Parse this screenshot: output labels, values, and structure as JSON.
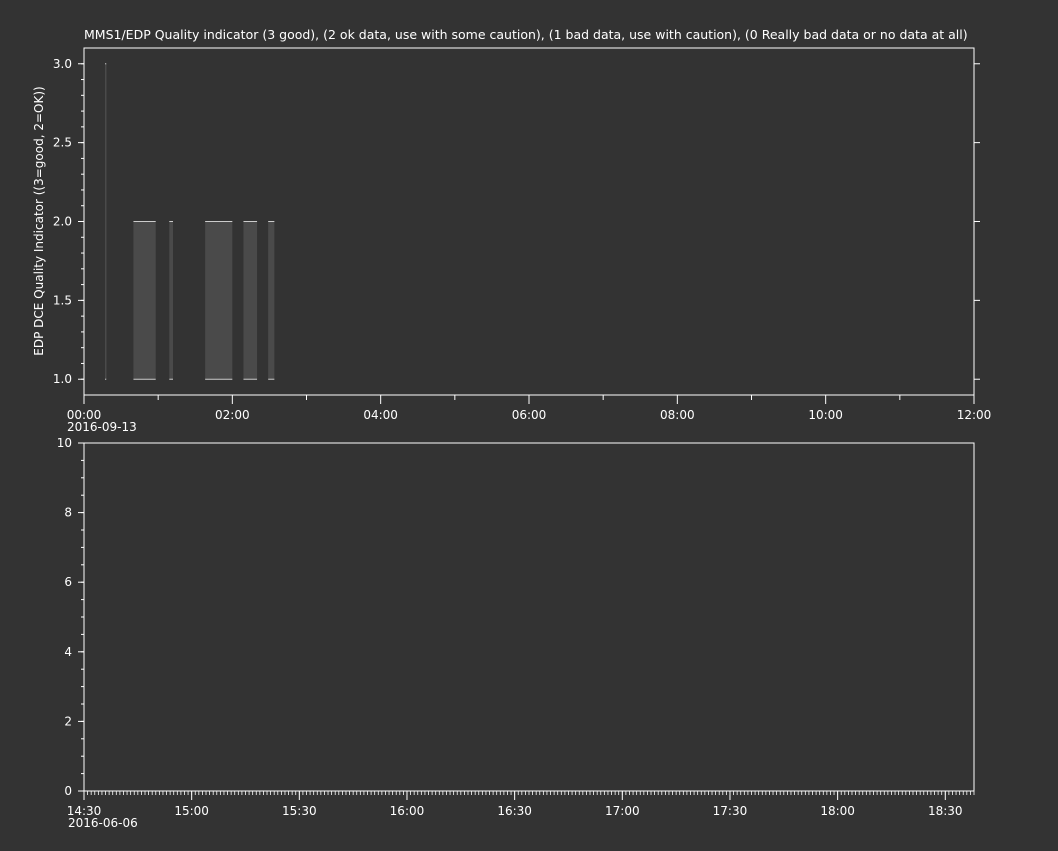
{
  "colors": {
    "background": "#333333",
    "foreground": "#ffffff",
    "data": "#4a4a4a",
    "trace": "#cccccc"
  },
  "chart_data": [
    {
      "type": "line",
      "title": "MMS1/EDP  Quality indicator (3 good), (2 ok data, use with some caution), (1 bad data, use with caution), (0 Really bad data or no data at all)",
      "ylabel": "EDP DCE Quality Indicator ((3=good, 2=OK))",
      "xlabel": "",
      "x_date": "2016-09-13",
      "xlim": [
        "00:00",
        "12:00"
      ],
      "ylim": [
        0.9,
        3.1
      ],
      "yticks": [
        "1.0",
        "1.5",
        "2.0",
        "2.5",
        "3.0"
      ],
      "xticks": [
        "00:00",
        "02:00",
        "04:00",
        "06:00",
        "08:00",
        "10:00",
        "12:00"
      ],
      "grid": false,
      "segments": [
        {
          "start": "00:17",
          "end": "00:18",
          "low": 1.0,
          "high": 3.0
        },
        {
          "start": "00:40",
          "end": "00:58",
          "low": 1.0,
          "high": 2.0
        },
        {
          "start": "01:09",
          "end": "01:12",
          "low": 1.0,
          "high": 2.0
        },
        {
          "start": "01:38",
          "end": "02:00",
          "low": 1.0,
          "high": 2.0
        },
        {
          "start": "02:09",
          "end": "02:20",
          "low": 1.0,
          "high": 2.0
        },
        {
          "start": "02:29",
          "end": "02:34",
          "low": 1.0,
          "high": 2.0
        }
      ]
    },
    {
      "type": "line",
      "title": "",
      "xlabel": "",
      "ylabel": "",
      "x_date": "2016-06-06",
      "xlim": [
        "14:30",
        "18:38"
      ],
      "ylim": [
        0,
        10
      ],
      "yticks": [
        "0",
        "2",
        "4",
        "6",
        "8",
        "10"
      ],
      "xticks": [
        "14:30",
        "15:00",
        "15:30",
        "16:00",
        "16:30",
        "17:00",
        "17:30",
        "18:00",
        "18:30"
      ],
      "grid": false,
      "series": []
    }
  ]
}
